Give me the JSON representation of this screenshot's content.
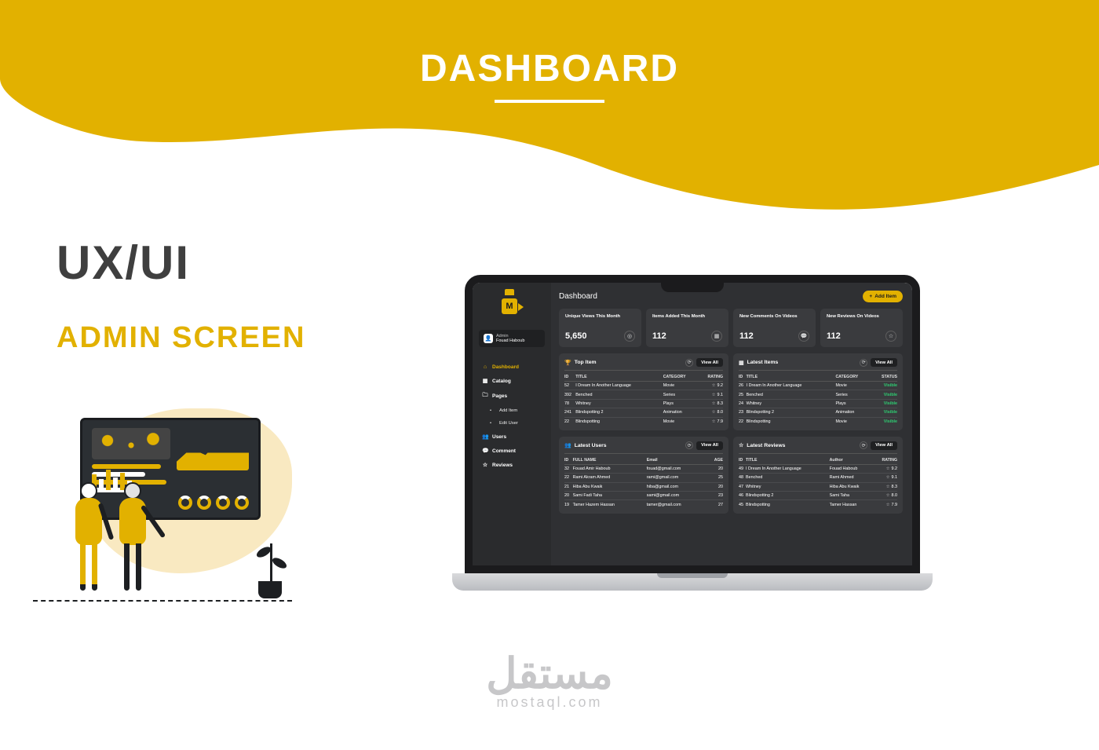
{
  "colors": {
    "accent": "#e2b100",
    "dark_text": "#3f3f3f"
  },
  "hero": {
    "title": "DASHBOARD"
  },
  "marketing": {
    "h1": "UX/UI",
    "h2": "ADMIN SCREEN"
  },
  "watermark": {
    "arabic": "مستقل",
    "latin": "mostaql.com"
  },
  "dashboard": {
    "page_title": "Dashboard",
    "add_button": "Add Item",
    "user": {
      "role": "Admin",
      "name": "Fouad Haboub"
    },
    "nav": {
      "dashboard": "Dashboard",
      "catalog": "Catalog",
      "pages": "Pages",
      "pages_sub": {
        "add_item": "Add Item",
        "edit_user": "Edit User"
      },
      "users": "Users",
      "comment": "Comment",
      "reviews": "Reviews"
    },
    "stats": [
      {
        "label": "Unique Views This Month",
        "value": "5,650",
        "icon": "◎"
      },
      {
        "label": "Items Added This Month",
        "value": "112",
        "icon": "▦"
      },
      {
        "label": "New Comments On Videos",
        "value": "112",
        "icon": "💬"
      },
      {
        "label": "New Reviews  On Videos",
        "value": "112",
        "icon": "☆"
      }
    ],
    "panels": {
      "top_item": {
        "title": "Top Item",
        "view_all": "View All",
        "cols": {
          "id": "ID",
          "title": "TITLE",
          "category": "CATEGORY",
          "rating": "RATING"
        },
        "rows": [
          {
            "id": "52",
            "title": "I Dream In Another Language",
            "category": "Movie",
            "rating": "9.2"
          },
          {
            "id": "392",
            "title": "Benched",
            "category": "Series",
            "rating": "9.1"
          },
          {
            "id": "78",
            "title": "Whitney",
            "category": "Plays",
            "rating": "8.3"
          },
          {
            "id": "241",
            "title": "Blindspotting 2",
            "category": "Animation",
            "rating": "8.0"
          },
          {
            "id": "22",
            "title": "Blindspotting",
            "category": "Movie",
            "rating": "7.9"
          }
        ]
      },
      "latest_items": {
        "title": "Latest Items",
        "view_all": "View All",
        "cols": {
          "id": "ID",
          "title": "TITLE",
          "category": "CATEGORY",
          "status": "STATUS"
        },
        "status_label": "Visible",
        "rows": [
          {
            "id": "26",
            "title": "I Dream In Another Language",
            "category": "Movie"
          },
          {
            "id": "25",
            "title": "Benched",
            "category": "Series"
          },
          {
            "id": "24",
            "title": "Whitney",
            "category": "Plays"
          },
          {
            "id": "23",
            "title": "Blindspotting 2",
            "category": "Animation"
          },
          {
            "id": "22",
            "title": "Blindspotting",
            "category": "Movie"
          }
        ]
      },
      "latest_users": {
        "title": "Latest Users",
        "view_all": "View All",
        "cols": {
          "id": "ID",
          "name": "FULL NAME",
          "email": "Email",
          "age": "AGE"
        },
        "rows": [
          {
            "id": "32",
            "name": "Fouad Amir Haboub",
            "email": "fouad@gmail.com",
            "age": "20"
          },
          {
            "id": "22",
            "name": "Rami Akram Ahmed",
            "email": "rami@gmail.com",
            "age": "25"
          },
          {
            "id": "21",
            "name": "Hiba Abu Kwaik",
            "email": "hiba@gmail.com",
            "age": "20"
          },
          {
            "id": "20",
            "name": "Sami Fadi Taha",
            "email": "sami@gmail.com",
            "age": "23"
          },
          {
            "id": "19",
            "name": "Tamer Hazem Hassan",
            "email": "tamer@gmail.com",
            "age": "27"
          }
        ]
      },
      "latest_reviews": {
        "title": "Latest Reviews",
        "view_all": "View All",
        "cols": {
          "id": "ID",
          "title": "TITLE",
          "author": "Author",
          "rating": "RATING"
        },
        "rows": [
          {
            "id": "49",
            "title": "I Dream In Another Language",
            "author": "Fouad Haboub",
            "rating": "9.2"
          },
          {
            "id": "48",
            "title": "Benched",
            "author": "Rami Ahmed",
            "rating": "9.1"
          },
          {
            "id": "47",
            "title": "Whitney",
            "author": "Hiba Abu Kwaik",
            "rating": "8.3"
          },
          {
            "id": "46",
            "title": "Blindspotting 2",
            "author": "Sami Taha",
            "rating": "8.0"
          },
          {
            "id": "45",
            "title": "Blindspotting",
            "author": "Tamer Hassan",
            "rating": "7.9"
          }
        ]
      }
    }
  }
}
